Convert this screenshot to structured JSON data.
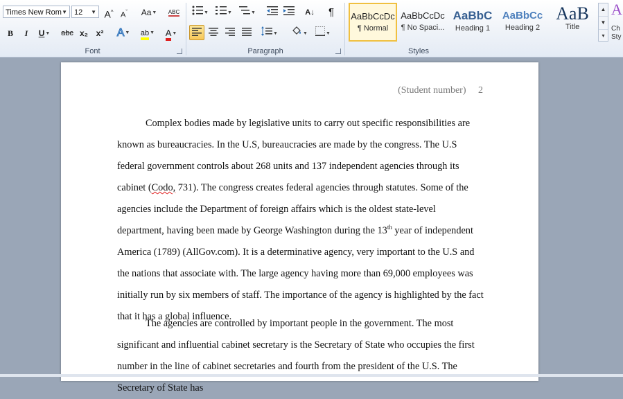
{
  "ribbon": {
    "font": {
      "label": "Font",
      "font_name": "Times New Rom",
      "font_size": "12",
      "grow": "A",
      "shrink": "A",
      "change_case": "Aa",
      "clear_format": "ABC",
      "bold": "B",
      "italic": "I",
      "underline": "U",
      "strikethrough": "abc",
      "subscript": "x₂",
      "superscript": "x²",
      "text_effects": "A",
      "highlight": "ab",
      "font_color": "A",
      "highlight_color": "#ffff00",
      "font_color_value": "#e02020"
    },
    "paragraph": {
      "label": "Paragraph",
      "sort": "A↓",
      "pilcrow": "¶"
    },
    "styles": {
      "label": "Styles",
      "tiles": [
        {
          "sample": "AaBbCcDc",
          "name": "¶ Normal"
        },
        {
          "sample": "AaBbCcDc",
          "name": "¶ No Spaci..."
        },
        {
          "sample": "AaBbC",
          "name": "Heading 1"
        },
        {
          "sample": "AaBbCc",
          "name": "Heading 2"
        },
        {
          "sample": "AaB",
          "name": "Title"
        }
      ],
      "change_styles": "Ch",
      "change_styles_2": "Sty"
    }
  },
  "document": {
    "header": {
      "student_number": "(Student number)",
      "page_number": "2"
    },
    "para1": {
      "before": "Complex bodies made by legislative units to carry out specific responsibilities are known as bureaucracies. In the U.S, bureaucracies are made by the congress. The U.S federal government controls about 268 units and 137 independent agencies through its cabinet (",
      "squiggle": "Codo,",
      "after": " 731). The congress creates federal agencies through statutes. Some of the agencies include the Department of foreign affairs which is the oldest state-level department, having been made by George Washington during the 13",
      "sup": "th",
      "end": " year of independent America (1789) (AllGov.com). It is a determinative agency, very important to the U.S and the nations that associate with. The large agency having more than 69,000 employees was initially run by six members of staff. The importance of the agency is highlighted by the fact that it has a global influence."
    },
    "para2": {
      "text": "The agencies are controlled by important people in the government. The most significant and influential cabinet secretary is the Secretary of State who occupies the first number in the line of cabinet secretaries and fourth from the president of the U.S. The Secretary of State has"
    }
  }
}
